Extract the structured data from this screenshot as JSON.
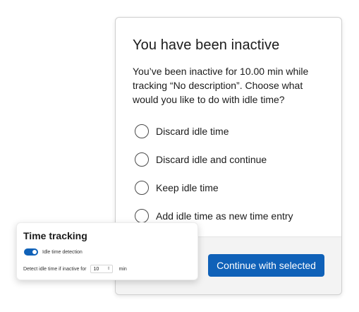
{
  "dialog": {
    "title": "You have been inactive",
    "message": "You’ve been inactive for 10.00 min while tracking “No description”. Choose what would you like to do with idle time?",
    "options": [
      {
        "label": "Discard idle time"
      },
      {
        "label": "Discard idle and continue"
      },
      {
        "label": "Keep idle time"
      },
      {
        "label": "Add idle time as new time entry"
      }
    ],
    "continue_label": "Continue with selected"
  },
  "settings": {
    "title": "Time tracking",
    "idle_detection_label": "Idle time detection",
    "idle_detection_enabled": true,
    "detect_label": "Detect idle time if inactive for",
    "detect_value": "10",
    "detect_unit": "min"
  },
  "colors": {
    "accent": "#0f61b8",
    "footer_bg": "#f3f3f3"
  }
}
